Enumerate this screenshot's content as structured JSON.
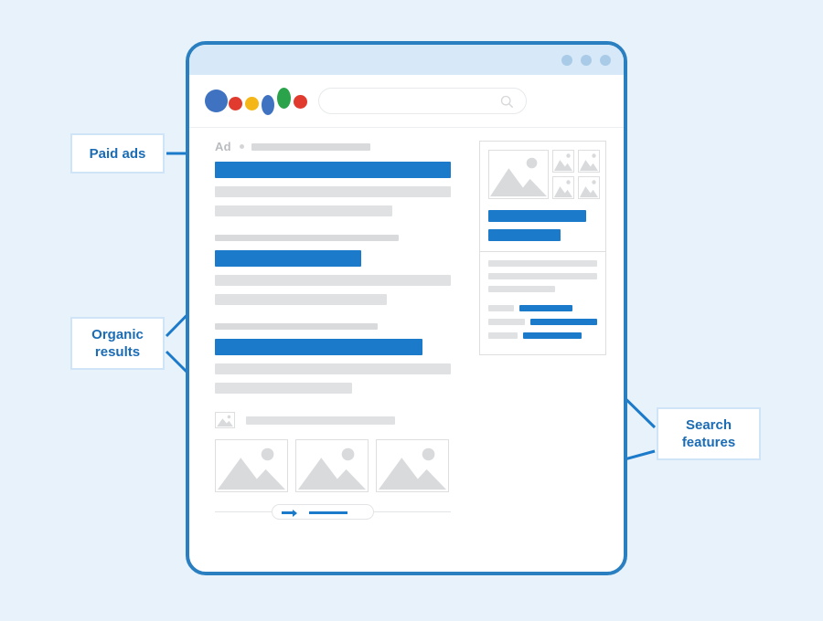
{
  "theme": {
    "page_bg": "#e8f2fb",
    "accent_blue": "#1b7ac9",
    "frame_blue": "#2a7fc0",
    "callout_text": "#1b6cb5",
    "callout_border": "#cfe4f6",
    "titlebar_bg": "#d7e9f9",
    "placeholder_gray": "#d8dadc",
    "ad_label_gray": "#b9bcbf"
  },
  "browser": {
    "titlebar": {
      "window_dots": [
        "window-dot-1",
        "window-dot-2",
        "window-dot-3"
      ]
    },
    "header": {
      "logo_name": "google-logo",
      "logo_dots": [
        {
          "name": "logo-dot-blue-large",
          "color": "#3f72c0"
        },
        {
          "name": "logo-dot-red-small",
          "color": "#e03b2e"
        },
        {
          "name": "logo-dot-yellow",
          "color": "#f5b717"
        },
        {
          "name": "logo-dot-blue-tall",
          "color": "#3f72c0"
        },
        {
          "name": "logo-dot-green-tall",
          "color": "#2aa34a"
        },
        {
          "name": "logo-dot-red",
          "color": "#e03b2e"
        }
      ],
      "search": {
        "value": "",
        "placeholder": "",
        "icon": "search-icon"
      }
    }
  },
  "results": {
    "ad": {
      "label": "Ad",
      "separator_icon": "bullet-dot-icon",
      "url_bar": "ad-url-placeholder",
      "title_bar": "ad-title-placeholder",
      "description_lines": [
        "ad-description-line-1",
        "ad-description-line-2"
      ]
    },
    "organic": [
      {
        "url_bar": "organic-1-url-placeholder",
        "title_bar": "organic-1-title-placeholder",
        "description_lines": [
          "organic-1-description-line-1",
          "organic-1-description-line-2"
        ]
      },
      {
        "url_bar": "organic-2-url-placeholder",
        "title_bar": "organic-2-title-placeholder",
        "description_lines": [
          "organic-2-description-line-1",
          "organic-2-description-line-2"
        ]
      }
    ],
    "image_pack": {
      "header_icon": "image-placeholder-icon",
      "header_bar": "image-pack-title-placeholder",
      "thumbnails": [
        "image-thumbnail-1",
        "image-thumbnail-2",
        "image-thumbnail-3"
      ],
      "pager": {
        "arrow_icon": "arrow-right-icon",
        "progress_bar": "carousel-progress-bar"
      }
    }
  },
  "knowledge_panel": {
    "hero_image": "knowledge-panel-hero-image",
    "thumbnails": [
      "knowledge-panel-thumb-1",
      "knowledge-panel-thumb-2",
      "knowledge-panel-thumb-3",
      "knowledge-panel-thumb-4"
    ],
    "title_bars": [
      "knowledge-panel-title",
      "knowledge-panel-subtitle"
    ],
    "description_lines": [
      "knowledge-panel-desc-line-1",
      "knowledge-panel-desc-line-2",
      "knowledge-panel-desc-line-3"
    ],
    "facts": [
      {
        "label": "fact-label-1",
        "value": "fact-value-1"
      },
      {
        "label": "fact-label-2",
        "value": "fact-value-2"
      },
      {
        "label": "fact-label-3",
        "value": "fact-value-3"
      }
    ]
  },
  "callouts": {
    "paid_ads": {
      "label": "Paid ads"
    },
    "organic_results": {
      "line1": "Organic",
      "line2": "results"
    },
    "search_features": {
      "line1": "Search",
      "line2": "features"
    }
  }
}
